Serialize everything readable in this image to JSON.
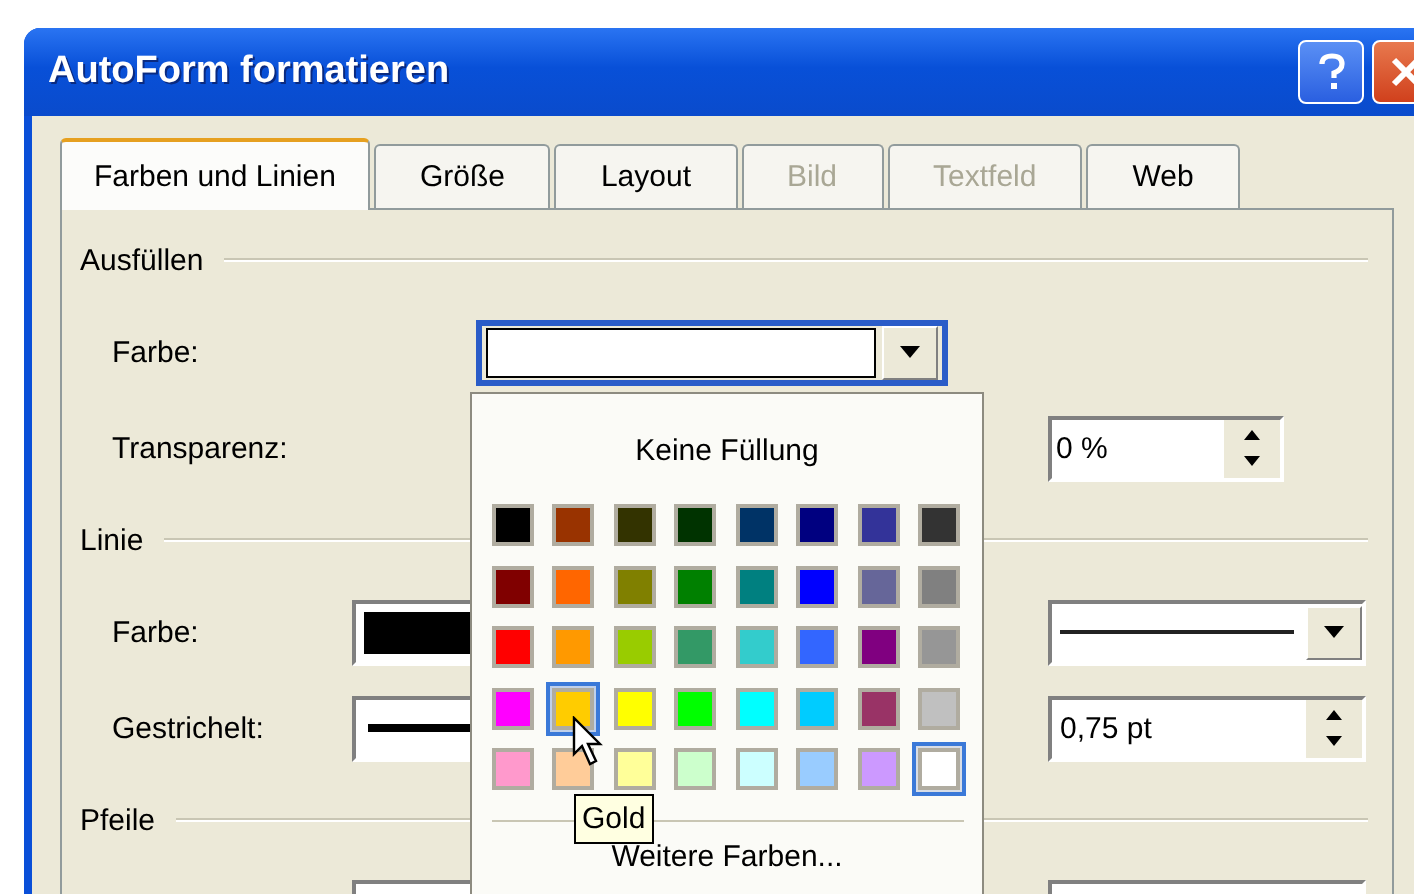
{
  "window": {
    "title": "AutoForm formatieren"
  },
  "tabs": [
    {
      "label": "Farben und Linien",
      "selected": true,
      "disabled": false
    },
    {
      "label": "Größe",
      "selected": false,
      "disabled": false
    },
    {
      "label": "Layout",
      "selected": false,
      "disabled": false
    },
    {
      "label": "Bild",
      "selected": false,
      "disabled": true
    },
    {
      "label": "Textfeld",
      "selected": false,
      "disabled": true
    },
    {
      "label": "Web",
      "selected": false,
      "disabled": false
    }
  ],
  "fill": {
    "heading": "Ausfüllen",
    "color_label": "Farbe:",
    "transparency_label": "Transparenz:",
    "transparency_value": "0 %"
  },
  "line": {
    "heading": "Linie",
    "color_label": "Farbe:",
    "dash_label": "Gestrichelt:",
    "weight_value": "0,75 pt"
  },
  "arrows": {
    "heading": "Pfeile"
  },
  "color_popup": {
    "no_fill": "Keine Füllung",
    "more_colors": "Weitere Farben...",
    "tooltip": "Gold",
    "swatches": [
      {
        "color": "#000000",
        "selected": false,
        "hovered": false
      },
      {
        "color": "#993300",
        "selected": false,
        "hovered": false
      },
      {
        "color": "#333300",
        "selected": false,
        "hovered": false
      },
      {
        "color": "#003300",
        "selected": false,
        "hovered": false
      },
      {
        "color": "#003366",
        "selected": false,
        "hovered": false
      },
      {
        "color": "#000080",
        "selected": false,
        "hovered": false
      },
      {
        "color": "#333399",
        "selected": false,
        "hovered": false
      },
      {
        "color": "#333333",
        "selected": false,
        "hovered": false
      },
      {
        "color": "#800000",
        "selected": false,
        "hovered": false
      },
      {
        "color": "#ff6600",
        "selected": false,
        "hovered": false
      },
      {
        "color": "#808000",
        "selected": false,
        "hovered": false
      },
      {
        "color": "#008000",
        "selected": false,
        "hovered": false
      },
      {
        "color": "#008080",
        "selected": false,
        "hovered": false
      },
      {
        "color": "#0000ff",
        "selected": false,
        "hovered": false
      },
      {
        "color": "#666699",
        "selected": false,
        "hovered": false
      },
      {
        "color": "#808080",
        "selected": false,
        "hovered": false
      },
      {
        "color": "#ff0000",
        "selected": false,
        "hovered": false
      },
      {
        "color": "#ff9900",
        "selected": false,
        "hovered": false
      },
      {
        "color": "#99cc00",
        "selected": false,
        "hovered": false
      },
      {
        "color": "#339966",
        "selected": false,
        "hovered": false
      },
      {
        "color": "#33cccc",
        "selected": false,
        "hovered": false
      },
      {
        "color": "#3366ff",
        "selected": false,
        "hovered": false
      },
      {
        "color": "#800080",
        "selected": false,
        "hovered": false
      },
      {
        "color": "#969696",
        "selected": false,
        "hovered": false
      },
      {
        "color": "#ff00ff",
        "selected": false,
        "hovered": false
      },
      {
        "color": "#ffcc00",
        "selected": false,
        "hovered": true
      },
      {
        "color": "#ffff00",
        "selected": false,
        "hovered": false
      },
      {
        "color": "#00ff00",
        "selected": false,
        "hovered": false
      },
      {
        "color": "#00ffff",
        "selected": false,
        "hovered": false
      },
      {
        "color": "#00ccff",
        "selected": false,
        "hovered": false
      },
      {
        "color": "#993366",
        "selected": false,
        "hovered": false
      },
      {
        "color": "#c0c0c0",
        "selected": false,
        "hovered": false
      },
      {
        "color": "#ff99cc",
        "selected": false,
        "hovered": false
      },
      {
        "color": "#ffcc99",
        "selected": false,
        "hovered": false
      },
      {
        "color": "#ffff99",
        "selected": false,
        "hovered": false
      },
      {
        "color": "#ccffcc",
        "selected": false,
        "hovered": false
      },
      {
        "color": "#ccffff",
        "selected": false,
        "hovered": false
      },
      {
        "color": "#99ccff",
        "selected": false,
        "hovered": false
      },
      {
        "color": "#cc99ff",
        "selected": false,
        "hovered": false
      },
      {
        "color": "#ffffff",
        "selected": true,
        "hovered": false
      }
    ]
  }
}
